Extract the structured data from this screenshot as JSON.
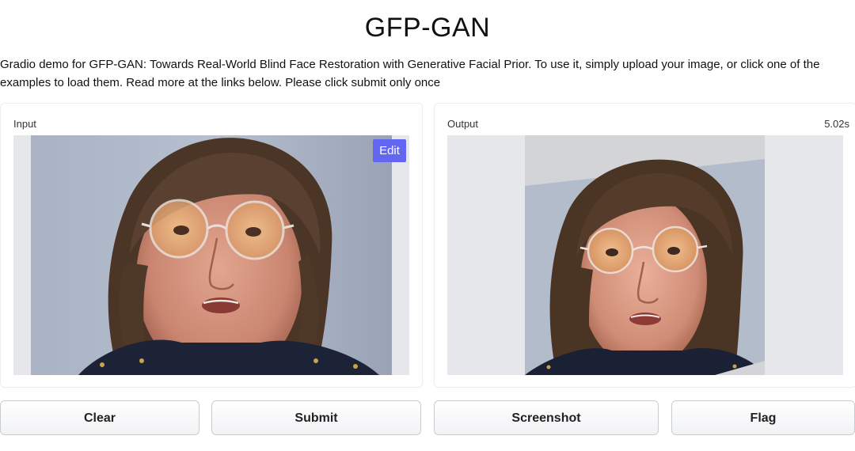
{
  "header": {
    "title": "GFP-GAN",
    "description": "Gradio demo for GFP-GAN: Towards Real-World Blind Face Restoration with Generative Facial Prior. To use it, simply upload your image, or click one of the examples to load them. Read more at the links below. Please click submit only once"
  },
  "input_panel": {
    "label": "Input",
    "edit_label": "Edit",
    "image": "portrait-photo"
  },
  "output_panel": {
    "label": "Output",
    "time": "5.02s",
    "image": "restored-portrait-photo"
  },
  "buttons": {
    "clear": "Clear",
    "submit": "Submit",
    "screenshot": "Screenshot",
    "flag": "Flag"
  },
  "colors": {
    "accent": "#6366f1",
    "image_bg": "#e5e7eb"
  }
}
